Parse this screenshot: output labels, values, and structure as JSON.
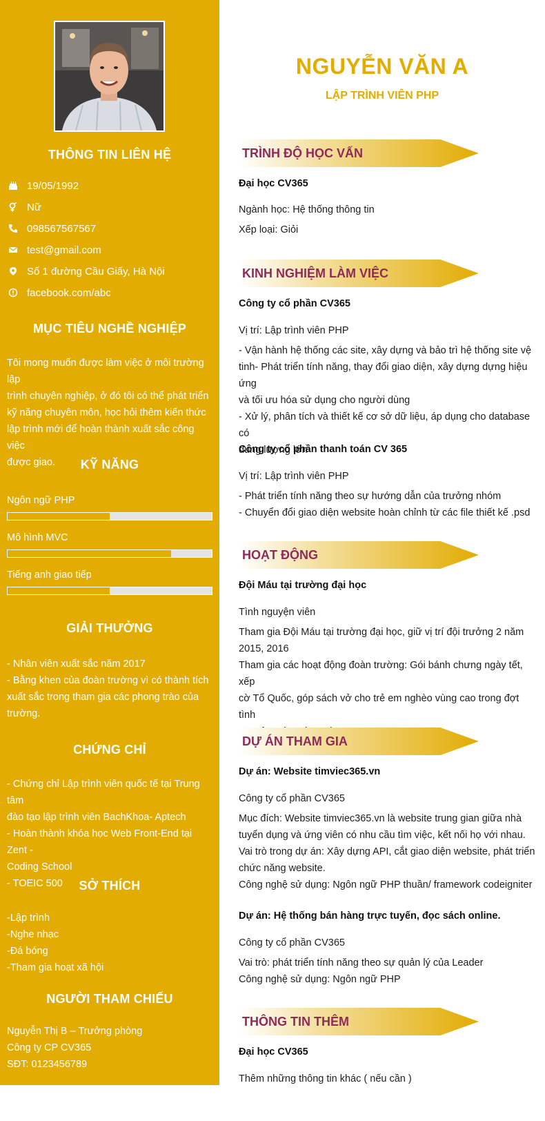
{
  "profile": {
    "name": "NGUYỄN VĂN A",
    "job_title": "LẬP TRÌNH VIÊN PHP"
  },
  "sidebar": {
    "contact_title": "THÔNG TIN LIÊN HỆ",
    "contact": [
      {
        "icon": "birthday-cake-icon",
        "text": "19/05/1992"
      },
      {
        "icon": "gender-icon",
        "text": "Nữ"
      },
      {
        "icon": "phone-icon",
        "text": "098567567567"
      },
      {
        "icon": "email-icon",
        "text": "test@gmail.com"
      },
      {
        "icon": "location-icon",
        "text": "Số 1 đường Cầu Giấy, Hà Nội"
      },
      {
        "icon": "facebook-icon",
        "text": "facebook.com/abc"
      }
    ],
    "objective_title": "MỤC TIÊU NGHỀ NGHIỆP",
    "objective_lines": [
      "Tôi mong muốn được làm việc ở môi trường lập",
      "trình chuyên nghiệp, ở đó tôi có thể phát triển",
      "kỹ năng chuyên môn, học hỏi thêm kiến thức",
      "lập trình mới để hoàn thành xuất sắc công việc",
      "được giao."
    ],
    "skills_title": "KỸ NĂNG",
    "skills": [
      {
        "label": "Ngôn ngữ PHP",
        "level": 0.5
      },
      {
        "label": "Mô hình MVC",
        "level": 0.8
      },
      {
        "label": "Tiếng anh giao tiếp",
        "level": 0.5
      }
    ],
    "awards_title": "GIẢI THƯỞNG",
    "awards_lines": [
      "- Nhân viên xuất sắc năm 2017",
      "- Bằng khen của đoàn trường vì có thành tích",
      "xuất sắc trong tham gia các phong trào của",
      "trường."
    ],
    "certs_title": "CHỨNG CHỈ",
    "certs_lines": [
      "- Chứng chỉ Lập trình viên quốc tế tại Trung tâm",
      "đào tạo lập trình viên BachKhoa- Aptech",
      "- Hoàn thành khóa học Web Front-End tại Zent -",
      "Coding School",
      "- TOEIC 500"
    ],
    "hobbies_title": "SỞ THÍCH",
    "hobbies_lines": [
      "-Lập trình",
      "-Nghe nhạc",
      "-Đá bóng",
      "-Tham gia hoạt xã hội"
    ],
    "reference_title": "NGƯỜI THAM CHIẾU",
    "reference_lines": [
      "Nguyễn Thị B  – Trưởng phòng",
      "Công ty CP CV365",
      "SĐT: 0123456789"
    ]
  },
  "education": {
    "title": "TRÌNH ĐỘ HỌC VẤN",
    "school": "Đại học CV365",
    "major": "Ngành học: Hệ thống thông tin",
    "grade": "Xếp loại: Giỏi"
  },
  "experience": {
    "title": "KINH NGHIỆM LÀM VIỆC",
    "jobs": [
      {
        "company": "Công ty cổ phần CV365",
        "position": "Vị trí: Lập trình viên PHP",
        "lines": [
          "- Vận hành hệ thống các site, xây dựng và bảo trì hệ thống site vệ",
          "tinh- Phát triển tính năng, thay đổi giao diện, xây dựng dựng hiệu ứng",
          "và tối ưu hóa sử dụng cho người dùng",
          "- Xử lý, phân tích và thiết kế cơ sở dữ liệu, áp dụng cho database có",
          "dung lượng lớn"
        ]
      },
      {
        "company": "Công ty cổ phần thanh toán CV 365",
        "position": "Vị trí: Lập trình viên PHP",
        "lines": [
          "- Phát triển tính năng theo sự hướng dẫn của trưởng nhóm",
          "- Chuyển đổi giao diện website hoàn chỉnh từ các file thiết kế .psd"
        ]
      }
    ]
  },
  "activities": {
    "title": "HOẠT ĐỘNG",
    "org": "Đội Máu tại trường đại học",
    "role": "Tình nguyện viên",
    "lines": [
      "Tham gia Đội Máu tại trường đại học, giữ vị trí đội trưởng 2 năm",
      "2015, 2016",
      "Tham gia các hoạt động đoàn trường: Gói bánh chưng ngày tết, xếp",
      "cờ Tổ Quốc, góp sách vở cho trẻ em nghèo vùng cao trong đợt tình",
      "nguyện Mùa Hè Xanh ..."
    ]
  },
  "projects": {
    "title": "DỰ ÁN THAM GIA",
    "items": [
      {
        "name": "Dự án: Website timviec365.vn",
        "company": "Công ty cổ phần CV365",
        "lines": [
          "Mục đích: Website timviec365.vn là website trung gian giữa nhà",
          "tuyển dụng và ứng viên có nhu cầu tìm việc, kết nối họ với nhau.",
          "Vai trò trong dự án: Xây dựng API, cắt giao diện website, phát triển",
          "chức năng website.",
          "Công nghệ sử dụng: Ngôn ngữ PHP thuần/ framework codeigniter"
        ]
      },
      {
        "name": "Dự án: Hệ thống bán hàng trực tuyến, đọc sách online.",
        "company": "Công ty cổ phần CV365",
        "lines": [
          "Vai trò: phát triển tính năng theo sự quản lý của Leader",
          "Công nghệ sử dụng: Ngôn ngữ PHP"
        ]
      }
    ]
  },
  "extra": {
    "title": "THÔNG TIN THÊM",
    "heading": "Đại học CV365",
    "text": "Thêm những thông tin khác ( nếu cần )"
  }
}
